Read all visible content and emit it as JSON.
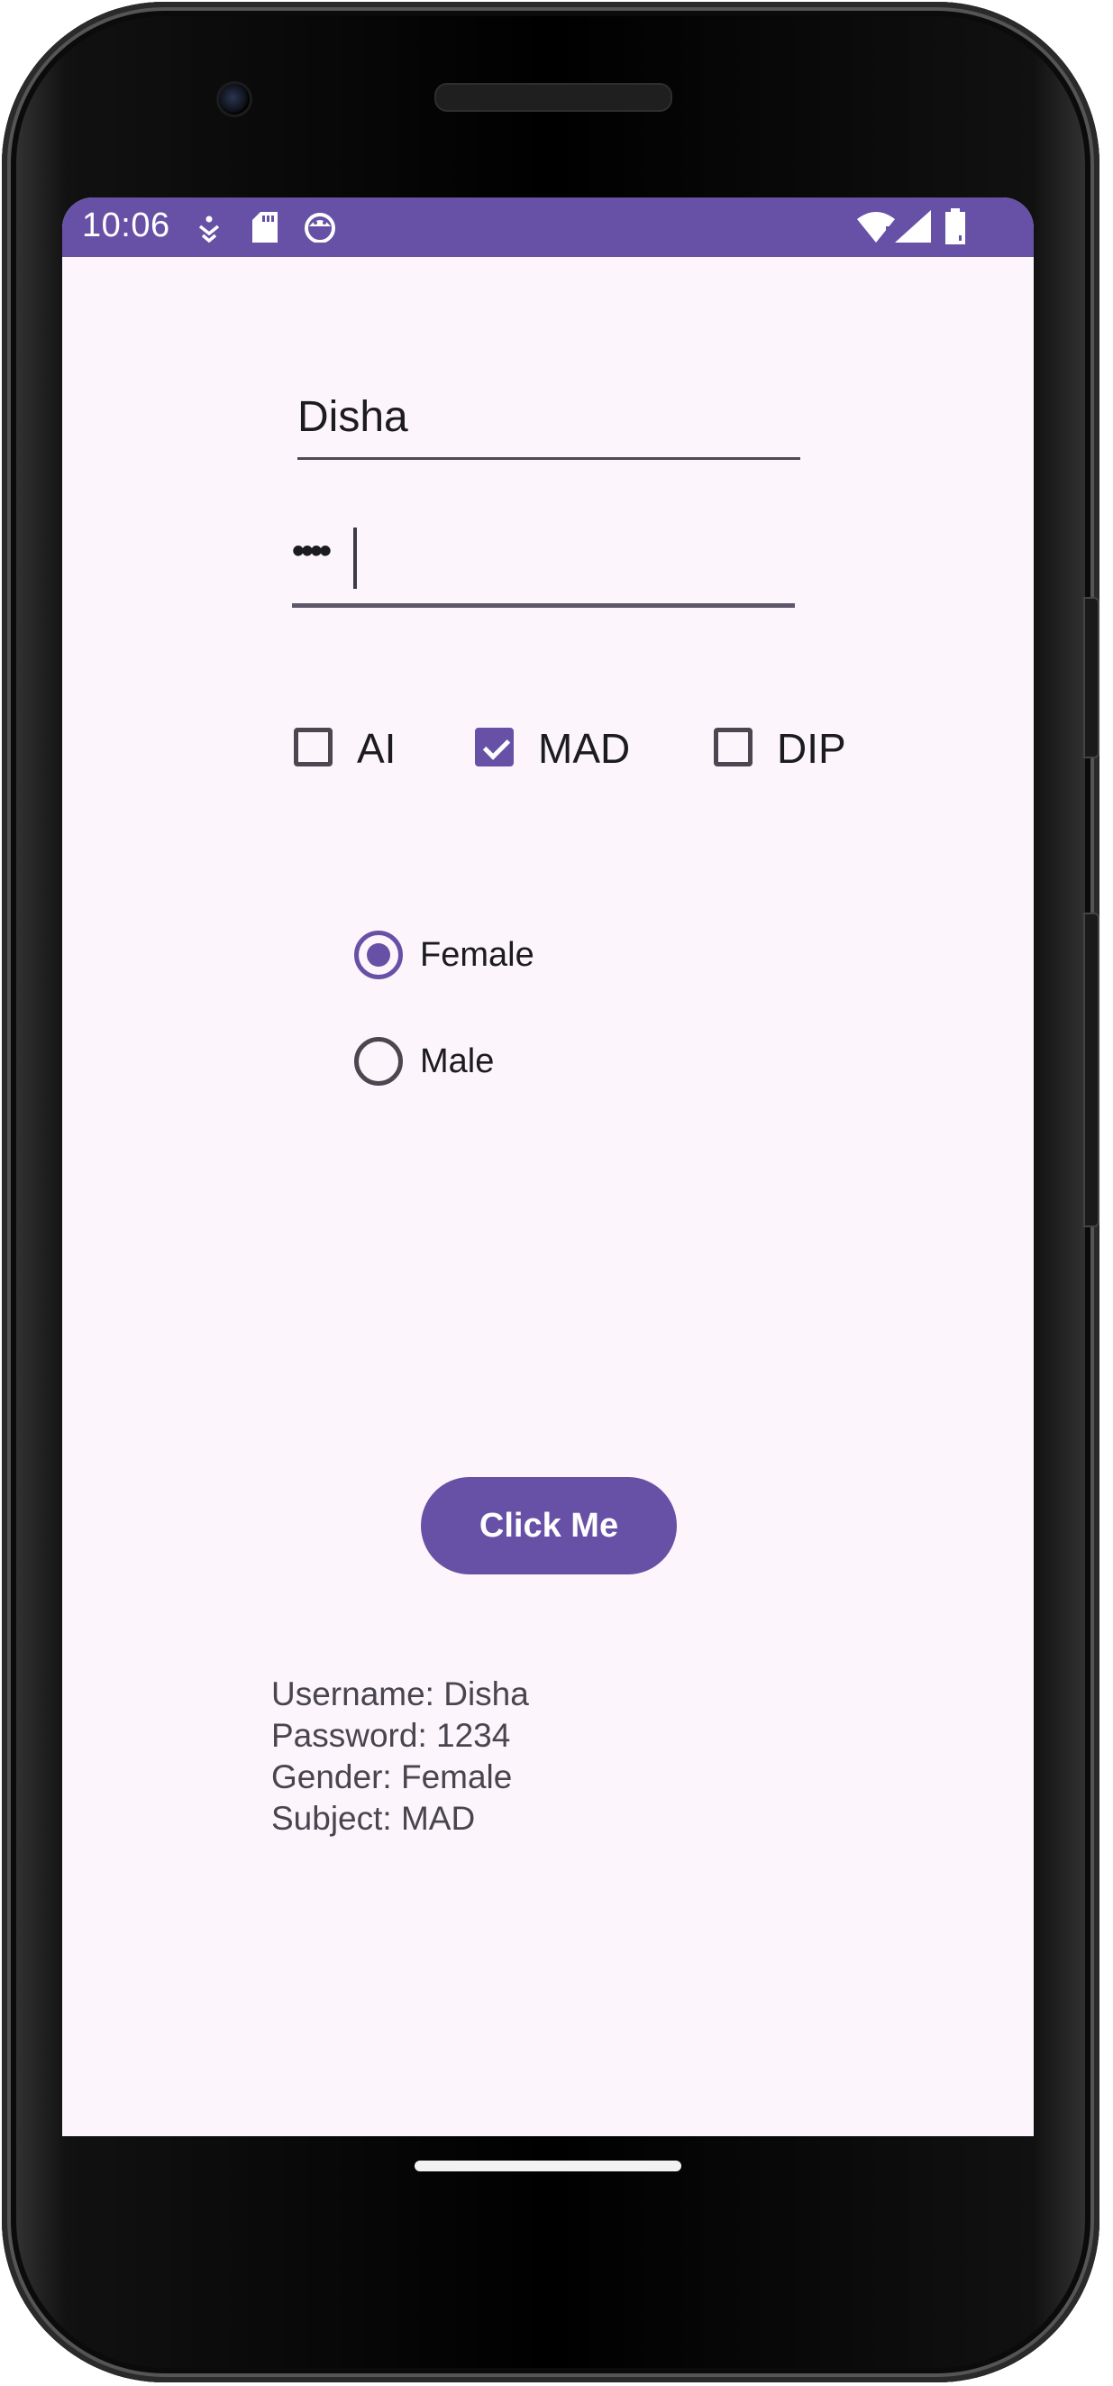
{
  "status_bar": {
    "time": "10:06",
    "color": "#6751a6"
  },
  "form": {
    "username_value": "Disha",
    "password_masked": "••••",
    "checkboxes": [
      {
        "label": "AI",
        "checked": false
      },
      {
        "label": "MAD",
        "checked": true
      },
      {
        "label": "DIP",
        "checked": false
      }
    ],
    "radios": [
      {
        "label": "Female",
        "selected": true
      },
      {
        "label": "Male",
        "selected": false
      }
    ],
    "button_label": "Click Me"
  },
  "output": {
    "line1": "Username: Disha",
    "line2": "Password: 1234",
    "line3": "Gender: Female",
    "line4": "Subject: MAD"
  },
  "icons": {
    "status_left": [
      "accessibility-icon",
      "sd-card-icon",
      "android-icon"
    ],
    "status_right": [
      "wifi-icon",
      "cell-signal-icon",
      "battery-icon"
    ]
  },
  "theme": {
    "accent": "#6751a6",
    "background": "#fcf5fb"
  }
}
